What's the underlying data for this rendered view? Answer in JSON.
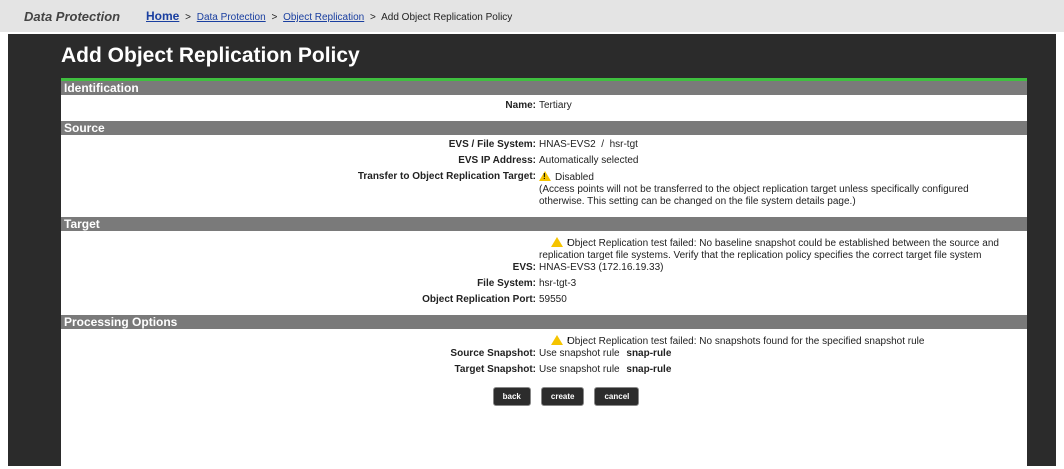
{
  "topbar": {
    "section": "Data Protection",
    "breadcrumb": {
      "home": "Home",
      "sep": ">",
      "data_protection": "Data Protection",
      "object_replication": "Object Replication",
      "current": "Add Object Replication Policy"
    }
  },
  "page": {
    "title": "Add Object Replication Policy"
  },
  "identification": {
    "header": "Identification",
    "name_label": "Name:",
    "name_value": "Tertiary"
  },
  "source": {
    "header": "Source",
    "evs_fs_label": "EVS / File System:",
    "evs_fs_value": "HNAS-EVS2  /  hsr-tgt",
    "evs_ip_label": "EVS IP Address:",
    "evs_ip_value": "Automatically selected",
    "transfer_label": "Transfer to Object Replication Target:",
    "transfer_value": "Disabled",
    "transfer_note": "(Access points will not be transferred to the object replication target unless specifically configured otherwise. This setting can be changed on the file system details page.)"
  },
  "target": {
    "header": "Target",
    "warning": "Object Replication test failed: No baseline snapshot could be established between the source and replication target file systems. Verify that the replication policy specifies the correct target file system",
    "evs_label": "EVS:",
    "evs_value": "HNAS-EVS3 (172.16.19.33)",
    "fs_label": "File System:",
    "fs_value": "hsr-tgt-3",
    "port_label": "Object Replication Port:",
    "port_value": "59550"
  },
  "processing": {
    "header": "Processing Options",
    "warning": "Object Replication test failed: No snapshots found for the specified snapshot rule",
    "source_label": "Source Snapshot:",
    "source_text": "Use snapshot rule",
    "source_rule": "snap-rule",
    "target_label": "Target Snapshot:",
    "target_text": "Use snapshot rule",
    "target_rule": "snap-rule"
  },
  "buttons": {
    "back": "back",
    "create": "create",
    "cancel": "cancel"
  },
  "colors": {
    "accent_green": "#3fbf3f",
    "warning_yellow": "#f5c400",
    "link_blue": "#1a3fa0"
  },
  "icons": {
    "warning": "warning-triangle-icon"
  }
}
